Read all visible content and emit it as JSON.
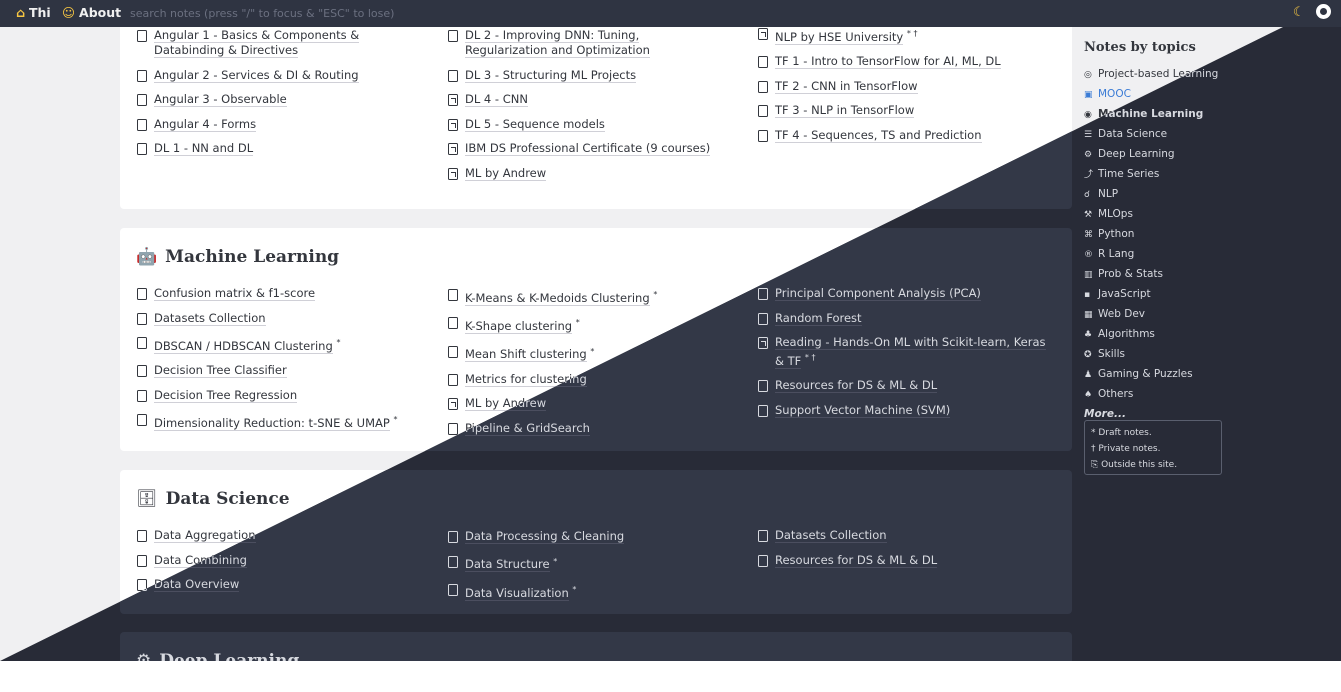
{
  "nav": {
    "home_label": "Thi",
    "about_label": "About",
    "search_placeholder": "search notes (press \"/\" to focus & \"ESC\" to lose)"
  },
  "cards": [
    {
      "id": "mooc",
      "title": "",
      "columns": [
        [
          {
            "text": "Angular 1 - Basics & Components & Databinding & Directives",
            "mark": "",
            "ext": false
          },
          {
            "text": "Angular 2 - Services & DI & Routing",
            "mark": "",
            "ext": false
          },
          {
            "text": "Angular 3 - Observable",
            "mark": "",
            "ext": false
          },
          {
            "text": "Angular 4 - Forms",
            "mark": "",
            "ext": false
          },
          {
            "text": "DL 1 - NN and DL",
            "mark": "",
            "ext": false
          }
        ],
        [
          {
            "text": "DL 2 - Improving DNN: Tuning, Regularization and Optimization",
            "mark": "",
            "ext": false
          },
          {
            "text": "DL 3 - Structuring ML Projects",
            "mark": "",
            "ext": false
          },
          {
            "text": "DL 4 - CNN",
            "mark": "",
            "ext": true
          },
          {
            "text": "DL 5 - Sequence models",
            "mark": "",
            "ext": true
          },
          {
            "text": "IBM DS Professional Certificate (9 courses)",
            "mark": "",
            "ext": true
          },
          {
            "text": "ML by Andrew",
            "mark": "",
            "ext": true
          }
        ],
        [
          {
            "text": "NLP by HSE University",
            "mark": "* †",
            "ext": true
          },
          {
            "text": "TF 1 - Intro to TensorFlow for AI, ML, DL",
            "mark": "",
            "ext": false
          },
          {
            "text": "TF 2 - CNN in TensorFlow",
            "mark": "",
            "ext": false
          },
          {
            "text": "TF 3 - NLP in TensorFlow",
            "mark": "",
            "ext": false
          },
          {
            "text": "TF 4 - Sequences, TS and Prediction",
            "mark": "",
            "ext": false
          }
        ]
      ]
    },
    {
      "id": "ml",
      "title": "Machine Learning",
      "icon": "🤖",
      "columns": [
        [
          {
            "text": "Confusion matrix & f1-score",
            "mark": "",
            "ext": false
          },
          {
            "text": "Datasets Collection",
            "mark": "",
            "ext": false
          },
          {
            "text": "DBSCAN / HDBSCAN Clustering",
            "mark": "*",
            "ext": false
          },
          {
            "text": "Decision Tree Classifier",
            "mark": "",
            "ext": false
          },
          {
            "text": "Decision Tree Regression",
            "mark": "",
            "ext": false
          },
          {
            "text": "Dimensionality Reduction: t-SNE & UMAP",
            "mark": "*",
            "ext": false
          }
        ],
        [
          {
            "text": "K-Means & K-Medoids Clustering",
            "mark": "*",
            "ext": false
          },
          {
            "text": "K-Shape clustering",
            "mark": "*",
            "ext": false
          },
          {
            "text": "Mean Shift clustering",
            "mark": "*",
            "ext": false
          },
          {
            "text": "Metrics for clustering",
            "mark": "",
            "ext": false
          },
          {
            "text": "ML by Andrew",
            "mark": "",
            "ext": true
          },
          {
            "text": "Pipeline & GridSearch",
            "mark": "",
            "ext": false
          }
        ],
        [
          {
            "text": "Principal Component Analysis (PCA)",
            "mark": "",
            "ext": false
          },
          {
            "text": "Random Forest",
            "mark": "",
            "ext": false
          },
          {
            "text": "Reading - Hands-On ML with Scikit-learn, Keras & TF",
            "mark": "* †",
            "ext": true
          },
          {
            "text": "Resources for DS & ML & DL",
            "mark": "",
            "ext": false
          },
          {
            "text": "Support Vector Machine (SVM)",
            "mark": "",
            "ext": false
          }
        ]
      ]
    },
    {
      "id": "ds",
      "title": "Data Science",
      "icon": "🗄",
      "columns": [
        [
          {
            "text": "Data Aggregation",
            "mark": "",
            "ext": false
          },
          {
            "text": "Data Combining",
            "mark": "",
            "ext": false
          },
          {
            "text": "Data Overview",
            "mark": "",
            "ext": false
          }
        ],
        [
          {
            "text": "Data Processing & Cleaning",
            "mark": "",
            "ext": false
          },
          {
            "text": "Data Structure",
            "mark": "*",
            "ext": false
          },
          {
            "text": "Data Visualization",
            "mark": "*",
            "ext": false
          }
        ],
        [
          {
            "text": "Datasets Collection",
            "mark": "",
            "ext": false
          },
          {
            "text": "Resources for DS & ML & DL",
            "mark": "",
            "ext": false
          }
        ]
      ]
    },
    {
      "id": "dl",
      "title": "Deep Learning",
      "icon": "⚙",
      "columns": [
        [],
        [],
        []
      ]
    }
  ],
  "sidebar": {
    "title": "Notes by topics",
    "topics": [
      {
        "label": "Project-based Learning",
        "icon": "◎"
      },
      {
        "label": "MOOC",
        "icon": "▣"
      },
      {
        "label": "Machine Learning",
        "icon": "◉"
      },
      {
        "label": "Data Science",
        "icon": "☰"
      },
      {
        "label": "Deep Learning",
        "icon": "⚙"
      },
      {
        "label": "Time Series",
        "icon": "⤴"
      },
      {
        "label": "NLP",
        "icon": "☌"
      },
      {
        "label": "MLOps",
        "icon": "⚒"
      },
      {
        "label": "Python",
        "icon": "⌘"
      },
      {
        "label": "R Lang",
        "icon": "®"
      },
      {
        "label": "Prob & Stats",
        "icon": "▥"
      },
      {
        "label": "JavaScript",
        "icon": "▪"
      },
      {
        "label": "Web Dev",
        "icon": "▦"
      },
      {
        "label": "Algorithms",
        "icon": "♣"
      },
      {
        "label": "Skills",
        "icon": "✪"
      },
      {
        "label": "Gaming & Puzzles",
        "icon": "♟"
      },
      {
        "label": "Others",
        "icon": "♠"
      }
    ],
    "more_label": "More...",
    "legend": {
      "draft": "* Draft notes.",
      "private": "† Private notes.",
      "outside": "Outside this site."
    }
  }
}
